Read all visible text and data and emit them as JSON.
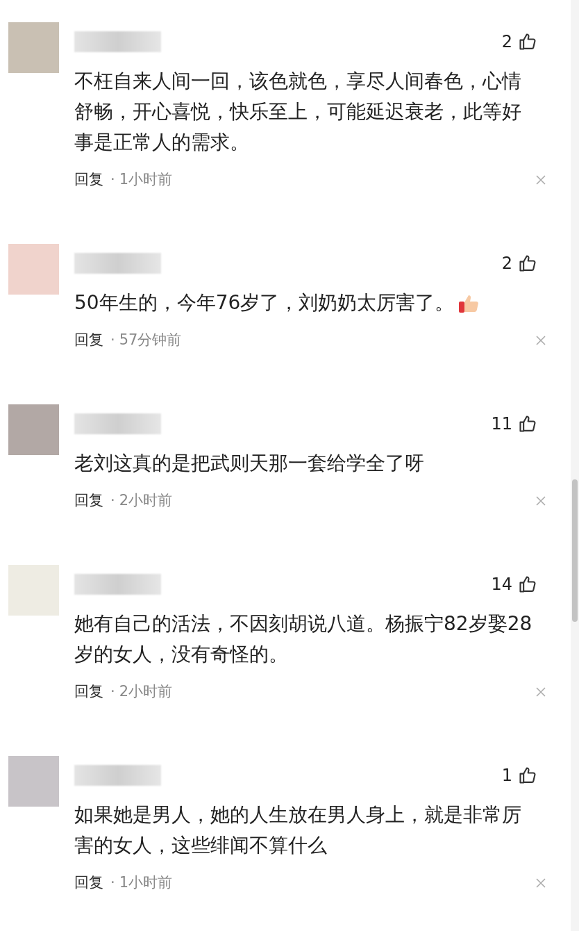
{
  "comments": [
    {
      "color": "#c9c0b3",
      "likes": "2",
      "text": "不枉自来人间一回，该色就色，享尽人间春色，心情舒畅，开心喜悦，快乐至上，可能延迟衰老，此等好事是正常人的需求。",
      "thumbs_up_emoji": false,
      "reply": "回复",
      "separator": "·",
      "time": "1小时前"
    },
    {
      "color": "#f0d3cc",
      "likes": "2",
      "text": "50年生的，今年76岁了，刘奶奶太厉害了。",
      "thumbs_up_emoji": true,
      "reply": "回复",
      "separator": "·",
      "time": "57分钟前"
    },
    {
      "color": "#b2a8a5",
      "likes": "11",
      "text": "老刘这真的是把武则天那一套给学全了呀",
      "thumbs_up_emoji": false,
      "reply": "回复",
      "separator": "·",
      "time": "2小时前"
    },
    {
      "color": "#eeece3",
      "likes": "14",
      "text": "她有自己的活法，不因刻胡说八道。杨振宁82岁娶28岁的女人，没有奇怪的。",
      "thumbs_up_emoji": false,
      "reply": "回复",
      "separator": "·",
      "time": "2小时前"
    },
    {
      "color": "#c8c4c8",
      "likes": "1",
      "text": "如果她是男人，她的人生放在男人身上，就是非常厉害的女人，这些绯闻不算什么",
      "thumbs_up_emoji": false,
      "reply": "回复",
      "separator": "·",
      "time": "1小时前"
    }
  ]
}
